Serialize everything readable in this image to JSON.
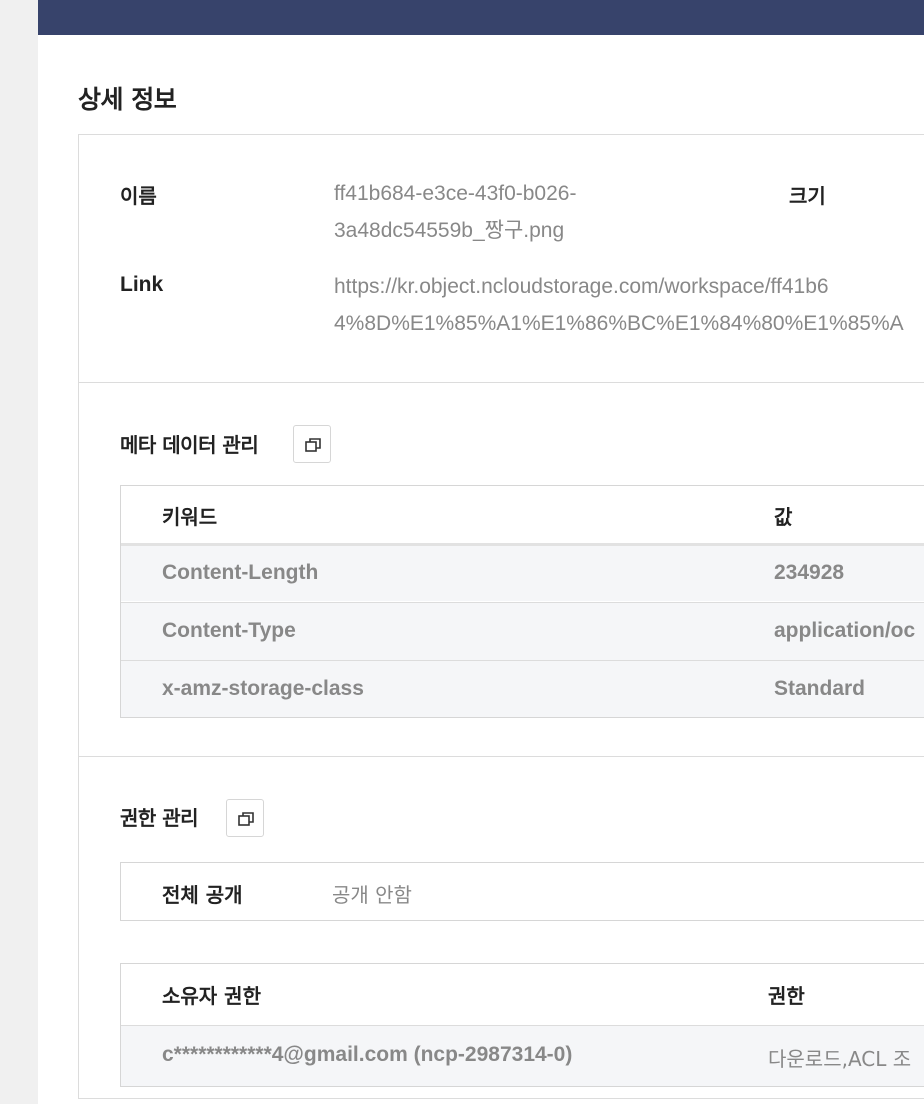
{
  "page_title": "상세 정보",
  "info": {
    "name_label": "이름",
    "name_line1": "ff41b684-e3ce-43f0-b026-",
    "name_line2": "3a48dc54559b_짱구.png",
    "size_label": "크기",
    "link_label": "Link",
    "link_line1": "https://kr.object.ncloudstorage.com/workspace/ff41b6",
    "link_line2": "4%8D%E1%85%A1%E1%86%BC%E1%84%80%E1%85%A"
  },
  "metadata": {
    "title": "메타 데이터 관리",
    "copy_icon": "copy-icon",
    "headers": [
      "키워드",
      "값"
    ],
    "rows": [
      {
        "key": "Content-Length",
        "value": "234928"
      },
      {
        "key": "Content-Type",
        "value": "application/oc"
      },
      {
        "key": "x-amz-storage-class",
        "value": "Standard"
      }
    ]
  },
  "permissions": {
    "title": "권한 관리",
    "copy_icon": "copy-icon",
    "public_label": "전체 공개",
    "public_value": "공개 안함",
    "headers": [
      "소유자 권한",
      "권한"
    ],
    "rows": [
      {
        "owner": "c************4@gmail.com (ncp-2987314-0)",
        "permission": "다운로드,ACL 조"
      }
    ]
  },
  "colors": {
    "topbar": "#37436b",
    "row_bg": "#f5f6f8",
    "muted_text": "#888888"
  }
}
